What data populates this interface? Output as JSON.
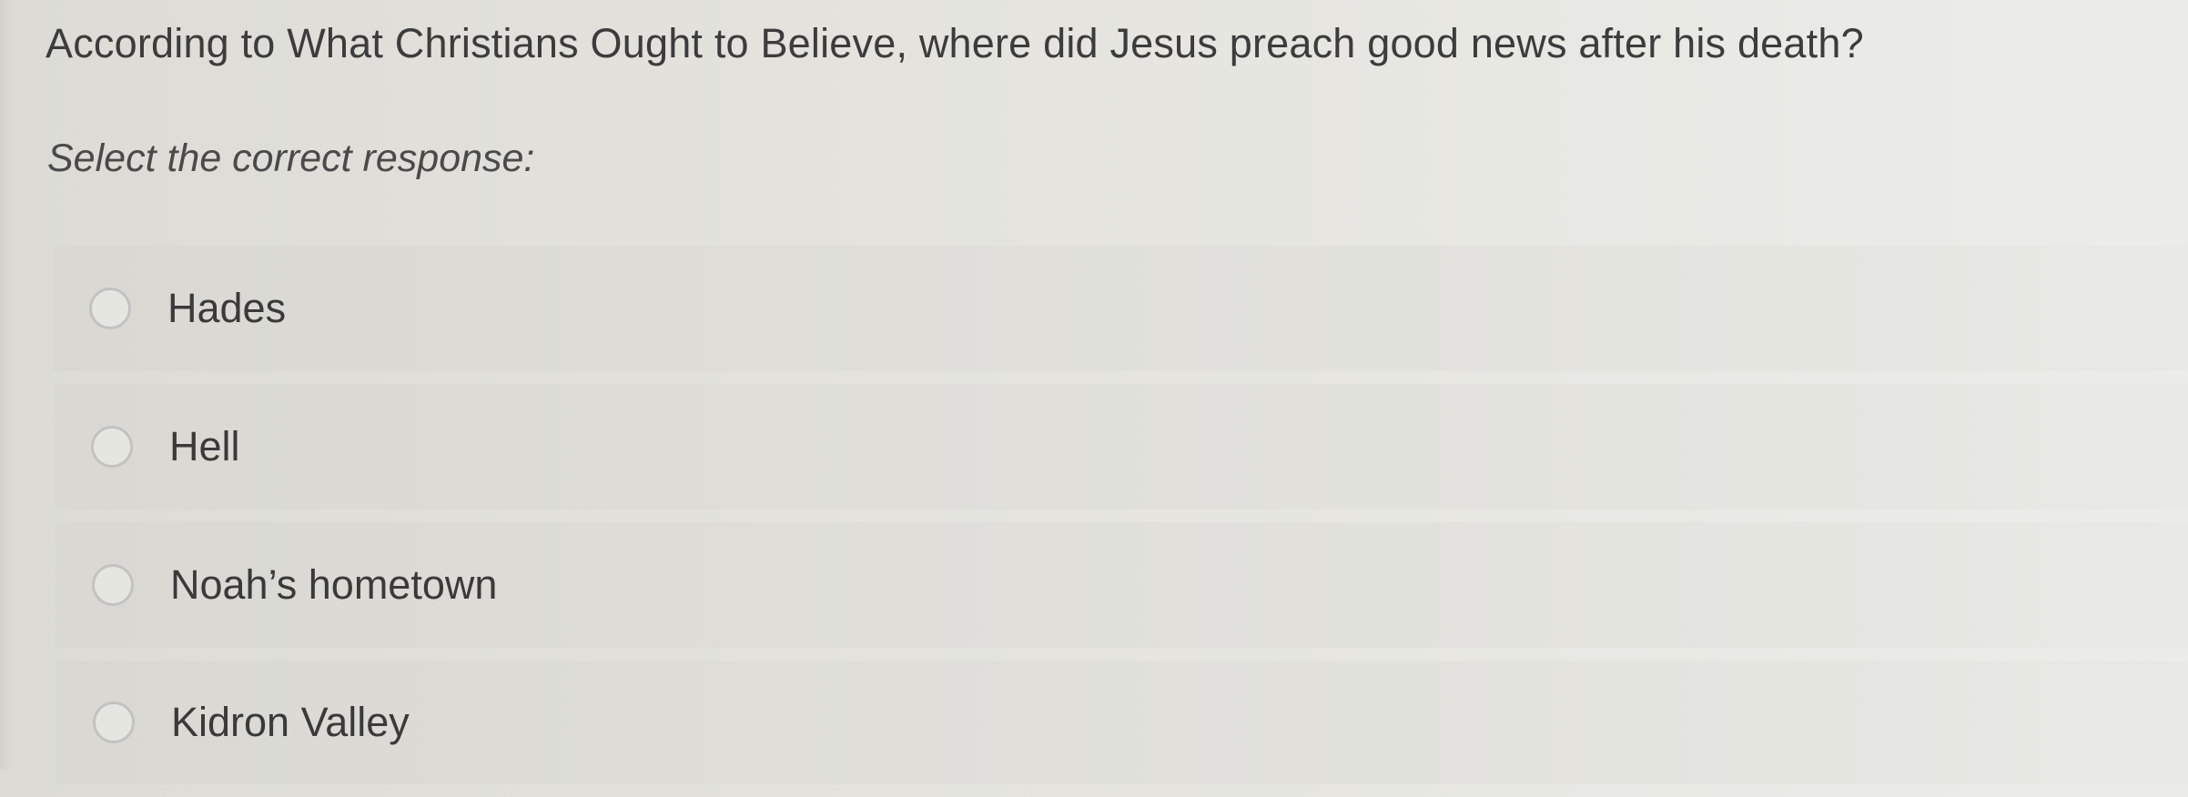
{
  "question": {
    "text": "According to What Christians Ought to Believe, where did Jesus preach good news after his death?"
  },
  "instruction": "Select the correct response:",
  "options": [
    {
      "label": "Hades"
    },
    {
      "label": "Hell"
    },
    {
      "label": "Noah’s hometown"
    },
    {
      "label": "Kidron Valley"
    }
  ]
}
